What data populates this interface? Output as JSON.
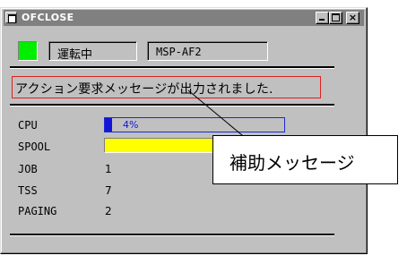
{
  "window": {
    "title": "OFCLOSE",
    "controls": {
      "minimize": "minimize",
      "maximize": "maximize",
      "close": "×"
    }
  },
  "header": {
    "status_color": "#00ee00",
    "status_text": "運転中",
    "system_name": "MSP-AF2"
  },
  "message": {
    "text": "アクション要求メッセージが出力されました.",
    "border_color": "#e02020"
  },
  "metrics": {
    "cpu": {
      "label": "CPU",
      "percent": 4,
      "display": "4%",
      "bar_color": "#1414d8"
    },
    "spool": {
      "label": "SPOOL",
      "percent": 100,
      "bar_color": "#ffff00"
    },
    "job": {
      "label": "JOB",
      "value": "1"
    },
    "tss": {
      "label": "TSS",
      "value": "7"
    },
    "paging": {
      "label": "PAGING",
      "value": "2"
    }
  },
  "callout": {
    "text": "補助メッセージ"
  }
}
